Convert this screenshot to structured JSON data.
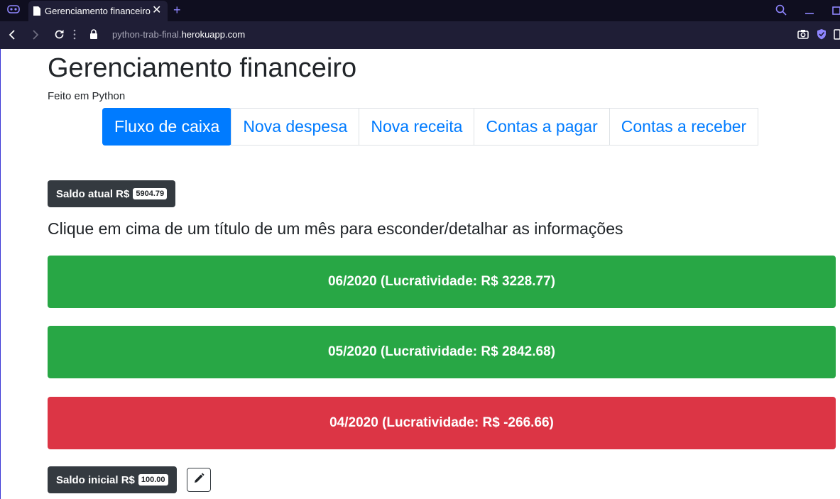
{
  "browser": {
    "tab_title": "Gerenciamento financeiro",
    "tab_close": "✕",
    "new_tab": "+",
    "url_prefix": "python-trab-final.",
    "url_domain": "herokuapp.com"
  },
  "header": {
    "title": "Gerenciamento financeiro",
    "subtitle": "Feito em Python"
  },
  "nav": {
    "items": [
      {
        "label": "Fluxo de caixa",
        "active": true
      },
      {
        "label": "Nova despesa",
        "active": false
      },
      {
        "label": "Nova receita",
        "active": false
      },
      {
        "label": "Contas a pagar",
        "active": false
      },
      {
        "label": "Contas a receber",
        "active": false
      }
    ]
  },
  "saldo_atual": {
    "label": "Saldo atual R$",
    "value": "5904.79"
  },
  "instruction": "Clique em cima de um título de um mês para esconder/detalhar as informações",
  "months": [
    {
      "label": "06/2020 (Lucratividade: R$ 3228.77)",
      "color": "#28a745"
    },
    {
      "label": "05/2020 (Lucratividade: R$ 2842.68)",
      "color": "#28a745"
    },
    {
      "label": "04/2020 (Lucratividade: R$ -266.66)",
      "color": "#dc3545"
    }
  ],
  "saldo_inicial": {
    "label": "Saldo inicial R$",
    "value": "100.00"
  },
  "icons": {
    "edit": "pencil-icon"
  },
  "colors": {
    "primary": "#007bff",
    "positive": "#28a745",
    "negative": "#dc3545",
    "dark": "#343a40"
  }
}
